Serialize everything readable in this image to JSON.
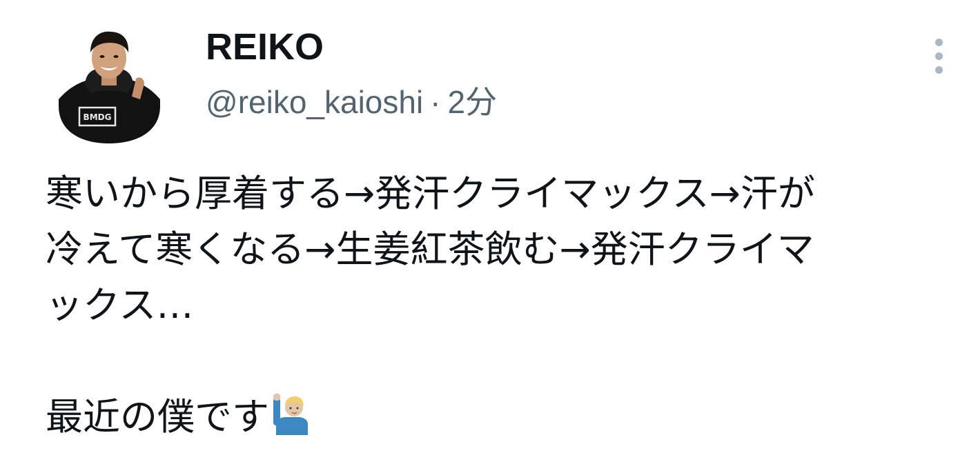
{
  "tweet": {
    "display_name": "REIKO",
    "handle": "@reiko_kaioshi",
    "separator": "·",
    "time": "2分",
    "avatar_shirt_text": "BMDG",
    "text_lines": [
      "寒いから厚着する→発汗クライマックス→汗が",
      "冷えて寒くなる→生姜紅茶飲む→発汗クライマ",
      "ックス…",
      "最近の僕です"
    ],
    "emoji": "person-raising-hand-emoji",
    "more_icon": "more-vertical-icon"
  },
  "colors": {
    "text_primary": "#0f1419",
    "text_secondary": "#536471",
    "icon_muted": "#aab8c2",
    "background": "#ffffff"
  }
}
